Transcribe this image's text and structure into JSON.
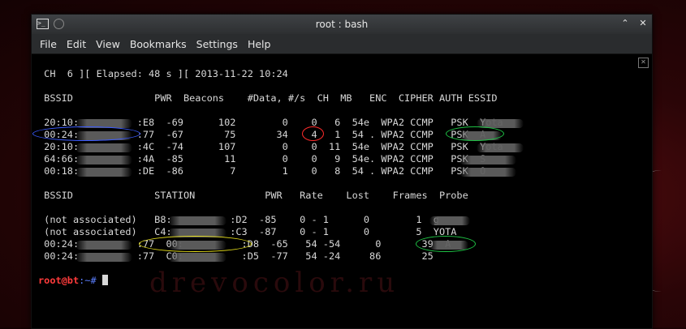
{
  "window": {
    "title": "root : bash"
  },
  "menu": [
    "File",
    "Edit",
    "View",
    "Bookmarks",
    "Settings",
    "Help"
  ],
  "terminal": {
    "status_line": " CH  6 ][ Elapsed: 48 s ][ 2013-11-22 10:24",
    "ap_header": " BSSID              PWR  Beacons    #Data, #/s  CH  MB   ENC  CIPHER AUTH ESSID",
    "ap_rows": [
      " 20:10:          :E8  -69      102        0    0   6  54e  WPA2 CCMP   PSK  Yota",
      " 00:24:          :77  -67       75       34    4   1  54 . WPA2 CCMP   PSK  A",
      " 20:10:          :4C  -74      107        0    0  11  54e  WPA2 CCMP   PSK  Yota",
      " 64:66:          :4A  -85       11        0    0   9  54e. WPA2 CCMP   PSK  S",
      " 00:18:          :DE  -86        7        1    0   8  54 . WPA2 CCMP   PSK  O"
    ],
    "station_header": " BSSID              STATION            PWR   Rate    Lost    Frames  Probe",
    "station_rows": [
      " (not associated)   B8:          :D2  -85    0 - 1      0        1  g",
      " (not associated)   C4:          :C3  -87    0 - 1      0        5  YOTA",
      " 00:24:          :77  00:          :D8  -65   54 -54      0       39  A",
      " 00:24:          :77  C0:          :D5  -77   54 -24     86       25"
    ],
    "prompt_user": "root@bt",
    "prompt_path": ":~#",
    "watermark": "drevocolor.ru"
  }
}
